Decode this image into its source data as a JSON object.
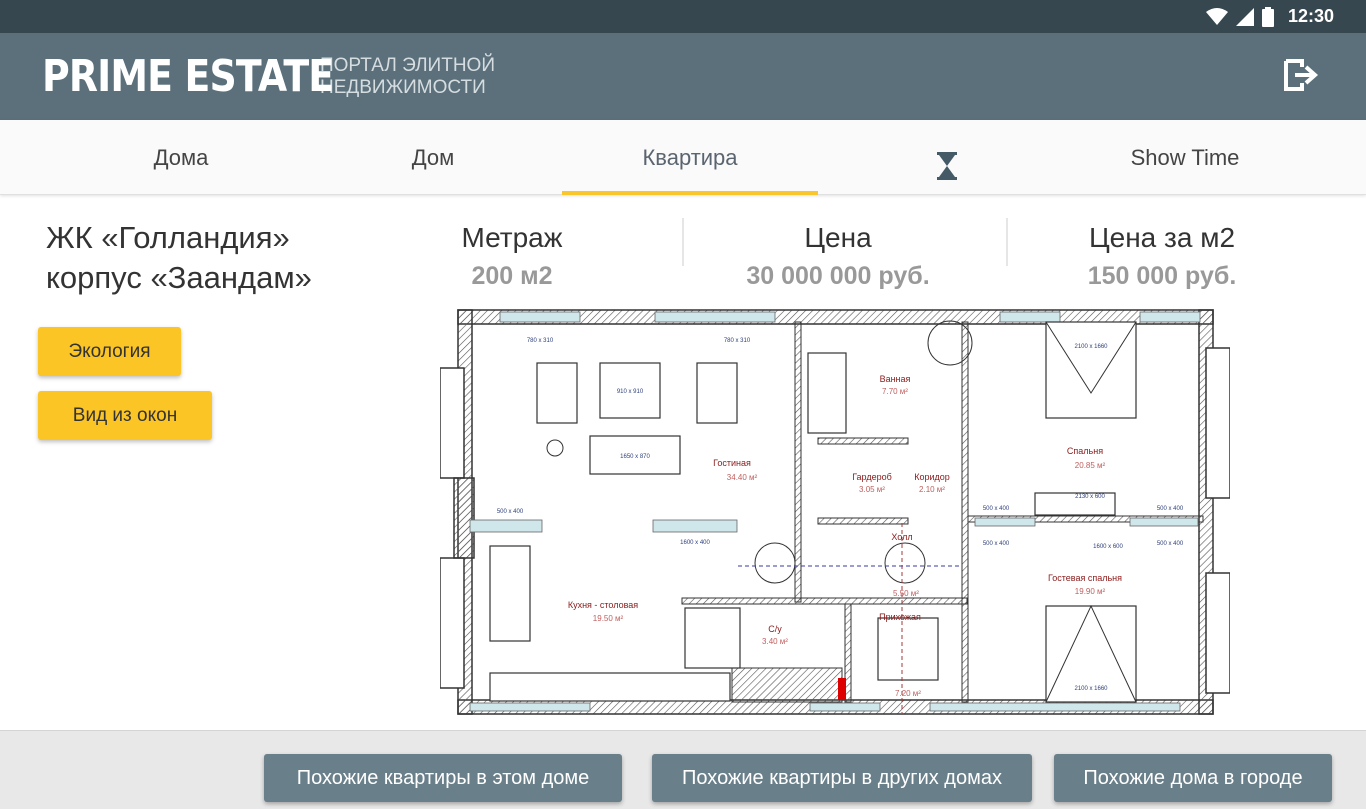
{
  "status_bar": {
    "time": "12:30",
    "icons": [
      "wifi-icon",
      "signal-icon",
      "battery-icon"
    ]
  },
  "header": {
    "logo_main": "PRIME ESTATE",
    "logo_sub": "ПОРТАЛ ЭЛИТНОЙ НЕДВИЖИМОСТИ",
    "logout_icon": "logout-icon"
  },
  "tabs": [
    {
      "label": "Дома"
    },
    {
      "label": "Дом"
    },
    {
      "label": "Квартира",
      "active": true
    },
    {
      "label": "",
      "icon": "hourglass-icon"
    },
    {
      "label": "Show Time"
    }
  ],
  "complex": {
    "line1": "ЖК «Голландия»",
    "line2": "корпус «Заандам»"
  },
  "buttons": {
    "ecology": "Экология",
    "window_view": "Вид из окон"
  },
  "stats": [
    {
      "label": "Метраж",
      "value": "200 м2"
    },
    {
      "label": "Цена",
      "value": "30 000 000 руб."
    },
    {
      "label": "Цена за м2",
      "value": "150 000 руб."
    }
  ],
  "floorplan": {
    "rooms": [
      {
        "name": "Гостиная",
        "area": "34.40 м²"
      },
      {
        "name": "Кухня - столовая",
        "area": "19.50 м²"
      },
      {
        "name": "Ванная",
        "area": "7.70 м²"
      },
      {
        "name": "Гардероб",
        "area": "3.05 м²"
      },
      {
        "name": "Коридор",
        "area": "2.10 м²"
      },
      {
        "name": "Холл",
        "area": "5.50 м²"
      },
      {
        "name": "Прихожая",
        "area": "7.20 м²"
      },
      {
        "name": "С/у",
        "area": "3.40 м²"
      },
      {
        "name": "Спальня",
        "area": "20.85 м²"
      },
      {
        "name": "Гостевая спальня",
        "area": "19.90 м²"
      }
    ],
    "furniture_labels": [
      "780 x 310",
      "780 x 310",
      "910 x 910",
      "1650 x 870",
      "900 x 460",
      "900 x 460",
      "2100 x 1660",
      "2100 x 1660",
      "1600 x 400",
      "500 x 400",
      "1700 x 850",
      "1600 x 600",
      "2400 x 1600",
      "2130 x 600",
      "500 x 400",
      "500 x 400",
      "500 x 400",
      "500 x 400",
      "1600 x 900"
    ]
  },
  "bottom_buttons": {
    "same_building": "Похожие квартиры в этом доме",
    "other_buildings": "Похожие квартиры в других домах",
    "city_houses": "Похожие  дома в городе"
  },
  "colors": {
    "header": "#5b707b",
    "status_bar": "#37474f",
    "accent": "#f9c62c",
    "bottom_button": "#697f8a"
  }
}
